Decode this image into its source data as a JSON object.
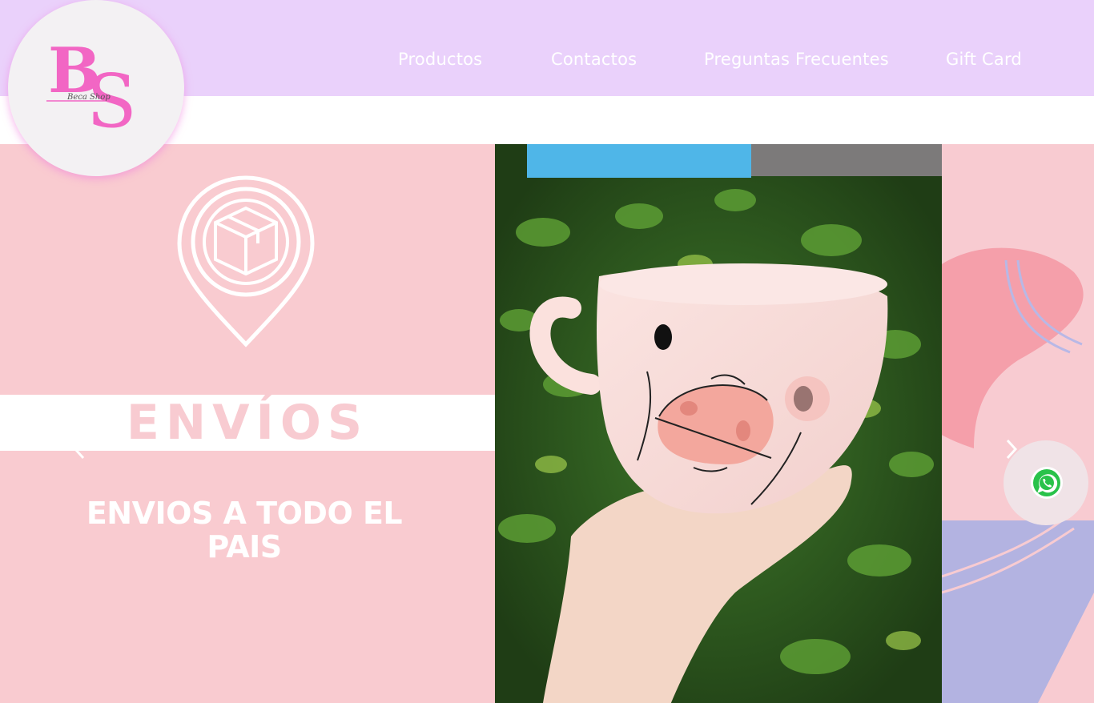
{
  "brand": {
    "monogram": "BS",
    "script_name": "Beca Shop",
    "colors": {
      "header_bg": "#ead1fb",
      "pink": "#f8cbd1",
      "magenta": "#f266c4",
      "white": "#ffffff"
    }
  },
  "nav": {
    "items": [
      {
        "label": "Productos"
      },
      {
        "label": "Contactos"
      },
      {
        "label": "Preguntas Frecuentes"
      },
      {
        "label": "Gift Card"
      }
    ]
  },
  "slider": {
    "slide": {
      "icon": "package-location-pin-icon",
      "banner": "ENVÍOS",
      "subtitle_line1": "ENVIOS A TODO EL",
      "subtitle_line2": "PAIS"
    },
    "photo": {
      "subject": "pig-face-mug-photo"
    },
    "prev_icon": "chevron-left-icon",
    "next_icon": "chevron-right-icon"
  },
  "whatsapp": {
    "icon": "whatsapp-icon"
  }
}
